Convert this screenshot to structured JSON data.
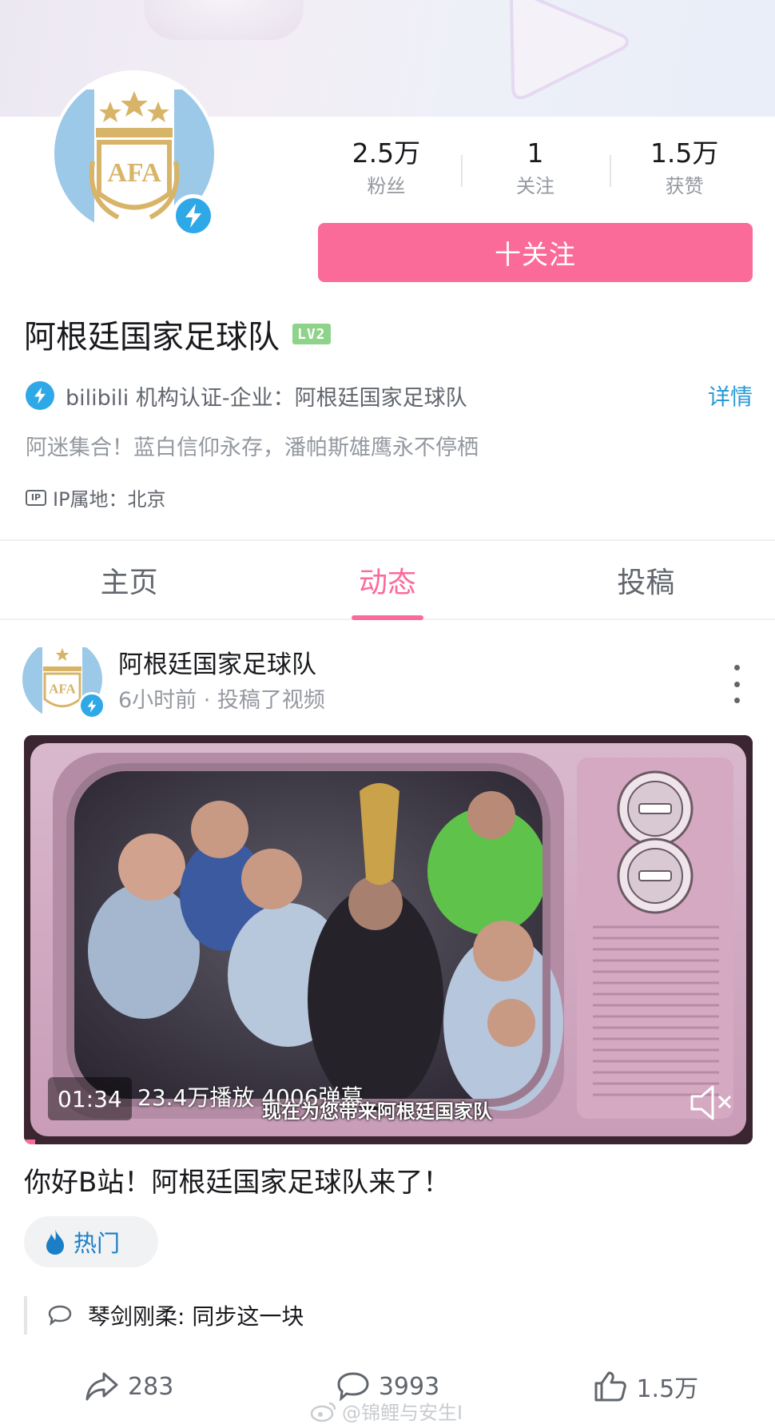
{
  "profile": {
    "name": "阿根廷国家足球队",
    "level": "LV2",
    "stats": [
      {
        "value": "2.5万",
        "label": "粉丝"
      },
      {
        "value": "1",
        "label": "关注"
      },
      {
        "value": "1.5万",
        "label": "获赞"
      }
    ],
    "follow_label": "十关注",
    "verify_text": "bilibili 机构认证-企业：阿根廷国家足球队",
    "verify_detail": "详情",
    "sign": "阿迷集合！蓝白信仰永存，潘帕斯雄鹰永不停栖",
    "ip_badge": "IP",
    "ip_text": "IP属地：北京"
  },
  "tabs": [
    {
      "label": "主页",
      "active": false
    },
    {
      "label": "动态",
      "active": true
    },
    {
      "label": "投稿",
      "active": false
    }
  ],
  "post": {
    "author": "阿根廷国家足球队",
    "meta": "6小时前 · 投稿了视频",
    "video": {
      "duration": "01:34",
      "plays": "23.4万播放  4006弹幕",
      "subtitle": "现在为您带来阿根廷国家队"
    },
    "title": "你好B站！阿根廷国家足球队来了！",
    "hot_tag": "热门",
    "comment": "琴剑刚柔: 同步这一块",
    "actions": {
      "share": "283",
      "comment": "3993",
      "like": "1.5万"
    }
  },
  "watermark": "@锦鲤与安生I",
  "colors": {
    "accent_pink": "#fb6b9a",
    "verify_blue": "#2fa8e8",
    "link_blue": "#2a9ad6"
  }
}
